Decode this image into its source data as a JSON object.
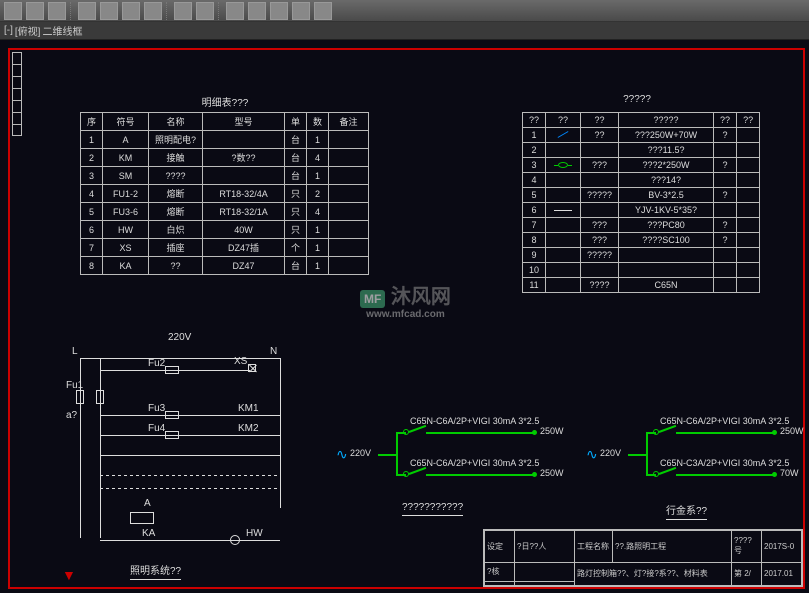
{
  "tabbar": {
    "prefix": "[-]",
    "view": "[俯视]",
    "frame": "二维线框"
  },
  "watermark": {
    "brand": "沐风网",
    "url": "www.mfcad.com"
  },
  "table1": {
    "title": "明细表???",
    "headers": [
      "序",
      "符号",
      "名称",
      "型号",
      "单",
      "数",
      "备注"
    ],
    "rows": [
      [
        "1",
        "A",
        "照明配电?",
        "",
        "台",
        "1",
        ""
      ],
      [
        "2",
        "KM",
        "接触",
        "?数??",
        "台",
        "4",
        ""
      ],
      [
        "3",
        "SM",
        "????",
        "",
        "台",
        "1",
        ""
      ],
      [
        "4",
        "FU1-2",
        "熔断",
        "RT18-32/4A",
        "只",
        "2",
        ""
      ],
      [
        "5",
        "FU3-6",
        "熔断",
        "RT18-32/1A",
        "只",
        "4",
        ""
      ],
      [
        "6",
        "HW",
        "白炽",
        "40W",
        "只",
        "1",
        ""
      ],
      [
        "7",
        "XS",
        "插座",
        "DZ47插",
        "个",
        "1",
        ""
      ],
      [
        "8",
        "KA",
        "??",
        "DZ47",
        "台",
        "1",
        ""
      ]
    ]
  },
  "table2": {
    "title": "?????",
    "headers": [
      "??",
      "??",
      "??",
      "?????",
      "??",
      "??"
    ],
    "rows": [
      [
        "1",
        "sym-diag",
        "??",
        "???250W+70W",
        "?",
        ""
      ],
      [
        "2",
        "",
        "",
        "???11.5?",
        "",
        ""
      ],
      [
        "3",
        "sym-circ",
        "???",
        "???2*250W",
        "?",
        ""
      ],
      [
        "4",
        "",
        "",
        "???14?",
        "",
        ""
      ],
      [
        "5",
        "",
        "?????",
        "BV-3*2.5",
        "?",
        ""
      ],
      [
        "6",
        "sym-line",
        "",
        "YJV-1KV-5*35?",
        "",
        ""
      ],
      [
        "7",
        "",
        "???",
        "???PC80",
        "?",
        ""
      ],
      [
        "8",
        "",
        "???",
        "????SC100",
        "?",
        ""
      ],
      [
        "9",
        "",
        "?????",
        "",
        "",
        ""
      ],
      [
        "10",
        "",
        "",
        "",
        "",
        ""
      ],
      [
        "11",
        "",
        "????",
        "C65N",
        "",
        ""
      ]
    ]
  },
  "circuit1": {
    "voltage": "220V",
    "labels": {
      "L": "L",
      "N": "N",
      "Fu1": "Fu1",
      "Fu2": "Fu2",
      "Fu3": "Fu3",
      "Fu4": "Fu4",
      "XS": "XS",
      "KM1": "KM1",
      "KM2": "KM2",
      "A": "A",
      "KA": "KA",
      "HW": "HW",
      "a": "a?"
    },
    "caption": "照明系统??"
  },
  "diagram2": {
    "supply": "220V",
    "branches": [
      "C65N-C6A/2P+VIGI 30mA 3*2.5",
      "C65N-C6A/2P+VIGI 30mA 3*2.5"
    ],
    "loads": [
      "250W",
      "250W"
    ],
    "caption": "???????????"
  },
  "diagram3": {
    "supply": "220V",
    "branches": [
      "C65N-C6A/2P+VIGI 30mA 3*2.5",
      "C65N-C3A/2P+VIGI 30mA 3*2.5"
    ],
    "loads": [
      "250W",
      "70W"
    ],
    "caption": "行金系??"
  },
  "titleblock": {
    "proj_lbl": "工程名称",
    "proj_val": "??.路照明工程",
    "design_lbl": "设定",
    "design_by": "?日??人",
    "check_lbl": "?核",
    "desc": "路灯控制箱??、灯?接?系??、材料表",
    "number_lbl": "????号",
    "sheet": "第 2/",
    "date": "2017.01",
    "code": "2017S-0"
  }
}
